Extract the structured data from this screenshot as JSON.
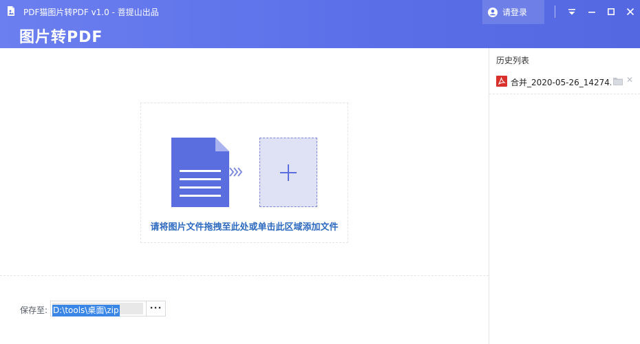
{
  "titlebar": {
    "window_title": "PDF猫图片转PDF v1.0 - 菩提山出品",
    "app_title": "图片转PDF",
    "login_label": "请登录"
  },
  "dropzone": {
    "hint": "请将图片文件拖拽至此处或单击此区域添加文件"
  },
  "save": {
    "label": "保存至:",
    "path": "D:\\tools\\桌面\\zip",
    "browse_label": "···"
  },
  "sidebar": {
    "title": "历史列表",
    "items": [
      {
        "name": "合并_2020-05-26_14274..."
      }
    ]
  },
  "colors": {
    "header": "#5a6ee8",
    "accent": "#5b6ee0",
    "hint_text": "#2d6ac0",
    "pdf_red": "#d9302c"
  }
}
